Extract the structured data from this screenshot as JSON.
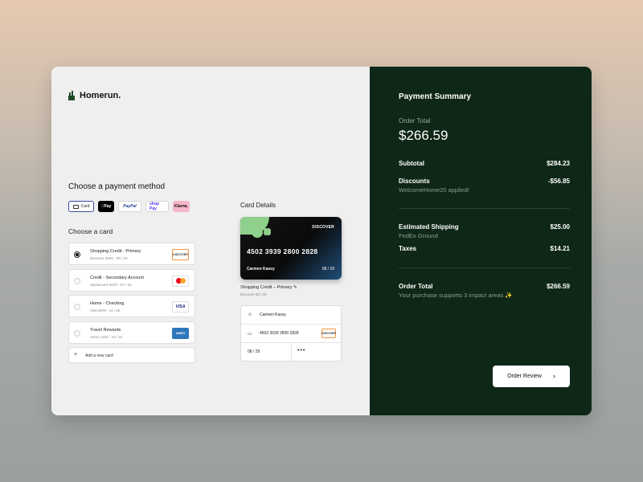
{
  "brand": {
    "name": "Homerun."
  },
  "payment_methods": {
    "heading": "Choose a payment method",
    "items": [
      {
        "label": "Card",
        "selected": true
      },
      {
        "label": "Pay",
        "icon": "apple-icon"
      },
      {
        "label": "PayPal"
      },
      {
        "label": "shop Pay"
      },
      {
        "label": "Klarna."
      }
    ]
  },
  "cards": {
    "heading": "Choose a card",
    "items": [
      {
        "title": "Shopping Credit - Primary",
        "sub": "Discover 2828 - 08 / 29",
        "logo": "DISCOVER",
        "selected": true
      },
      {
        "title": "Credit - Secondary Account",
        "sub": "Mastercard 5678 - 07 / 25",
        "logo": "mastercard"
      },
      {
        "title": "Home - Checking",
        "sub": "Visa 5678 - 11 / 26",
        "logo": "VISA"
      },
      {
        "title": "Travel Rewards",
        "sub": "Amex 1234 - 10 / 24",
        "logo": "AMEX"
      }
    ],
    "add_label": "Add a new card"
  },
  "details": {
    "heading": "Card Details",
    "card_brand": "DISCOVER",
    "card_number": "4502 3939 2800 2828",
    "card_holder": "Carmen Kassy",
    "card_expiry": "08 / 29",
    "selected_title": "Shopping Credit – Primary",
    "selected_sub": "Discover 08 / 29",
    "field_name": "Carmen Kassy",
    "field_number": "4502 3939 2800 2828",
    "field_logo": "DISCOVER",
    "field_expiry": "08 / 29",
    "field_cvc": "•••"
  },
  "summary": {
    "title": "Payment Summary",
    "order_total_label": "Order Total",
    "order_total_value": "$266.59",
    "subtotal_label": "Subtotal",
    "subtotal_value": "$284.23",
    "discounts_label": "Discounts",
    "discounts_value": "-$56.85",
    "discounts_note": "WelcomeHome20 applied!",
    "shipping_label": "Estimated Shipping",
    "shipping_value": "$25.00",
    "shipping_carrier": "FedEx Ground",
    "taxes_label": "Taxes",
    "taxes_value": "$14.21",
    "total_label": "Order Total",
    "total_value": "$266.59",
    "impact_note": "Your purchase supports 3 impact areas ✨",
    "review_button": "Order Review"
  },
  "colors": {
    "panel_dark": "#0e2716",
    "accent_green": "#8fd08c",
    "left_bg": "#efefef"
  }
}
